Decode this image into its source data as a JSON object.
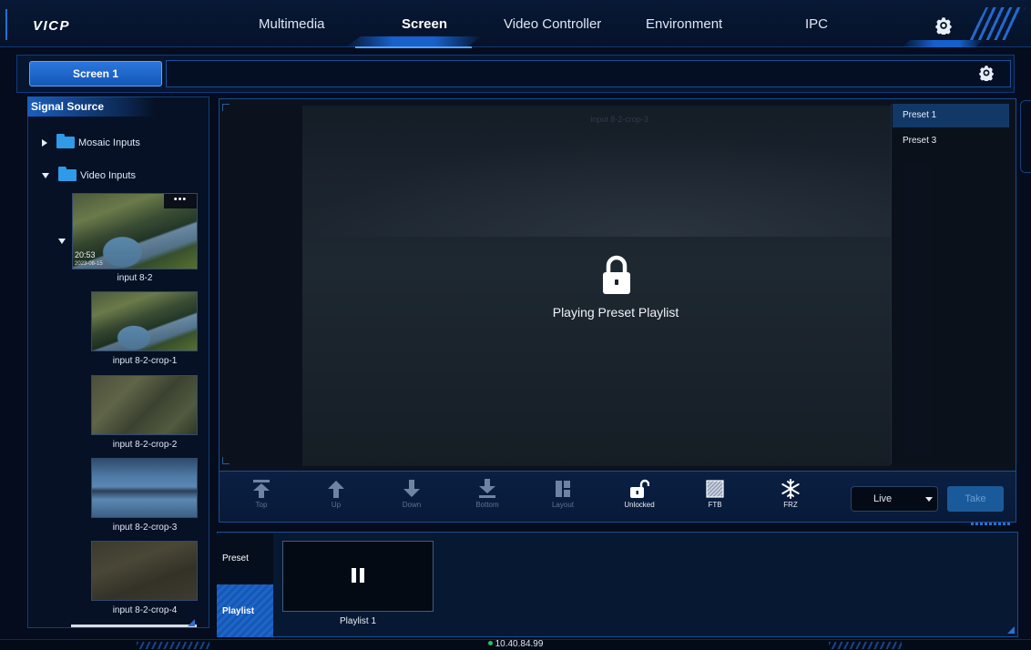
{
  "app": {
    "logo": "VICP"
  },
  "nav": {
    "tabs": [
      {
        "label": "Multimedia"
      },
      {
        "label": "Screen"
      },
      {
        "label": "Video Controller"
      },
      {
        "label": "Environment"
      },
      {
        "label": "IPC"
      }
    ],
    "active_index": 1,
    "settings_icon": "gear-icon"
  },
  "screen_bar": {
    "screen_label": "Screen 1",
    "settings_icon": "gear-icon"
  },
  "signal_source": {
    "title": "Signal Source",
    "tree": [
      {
        "label": "Mosaic Inputs",
        "expanded": false
      },
      {
        "label": "Video Inputs",
        "expanded": true
      }
    ],
    "inputs": [
      {
        "label": "input 8-2",
        "more": "•••",
        "time": "20:53",
        "sub": "2023-08-15"
      },
      {
        "label": "input 8-2-crop-1"
      },
      {
        "label": "input 8-2-crop-2"
      },
      {
        "label": "input 8-2-crop-3"
      },
      {
        "label": "input 8-2-crop-4"
      }
    ]
  },
  "preview": {
    "canvas_title": "input 8-2-crop-3",
    "status_text": "Playing Preset Playlist",
    "presets": [
      {
        "label": "Preset 1",
        "active": true
      },
      {
        "label": "Preset 3",
        "active": false
      }
    ]
  },
  "toolbar": {
    "tools": [
      {
        "label": "Top",
        "icon": "move-top-icon",
        "enabled": false
      },
      {
        "label": "Up",
        "icon": "arrow-up-icon",
        "enabled": false
      },
      {
        "label": "Down",
        "icon": "arrow-down-icon",
        "enabled": false
      },
      {
        "label": "Bottom",
        "icon": "move-bottom-icon",
        "enabled": false
      },
      {
        "label": "Layout",
        "icon": "layout-icon",
        "enabled": false
      },
      {
        "label": "Unlocked",
        "icon": "unlock-icon",
        "enabled": true
      },
      {
        "label": "FTB",
        "icon": "ftb-icon",
        "enabled": true
      },
      {
        "label": "FRZ",
        "icon": "snowflake-icon",
        "enabled": true
      }
    ],
    "mode_select": "Live",
    "take_label": "Take"
  },
  "bottom": {
    "tabs": [
      {
        "label": "Preset"
      },
      {
        "label": "Playlist"
      }
    ],
    "active_tab": "Playlist",
    "playlists": [
      {
        "label": "Playlist 1",
        "state": "pause-icon"
      }
    ]
  },
  "status": {
    "ip": "10.40.84.99",
    "connection_color": "#22c55e"
  },
  "colors": {
    "accent": "#1b6fe6",
    "background": "#040c1d"
  }
}
